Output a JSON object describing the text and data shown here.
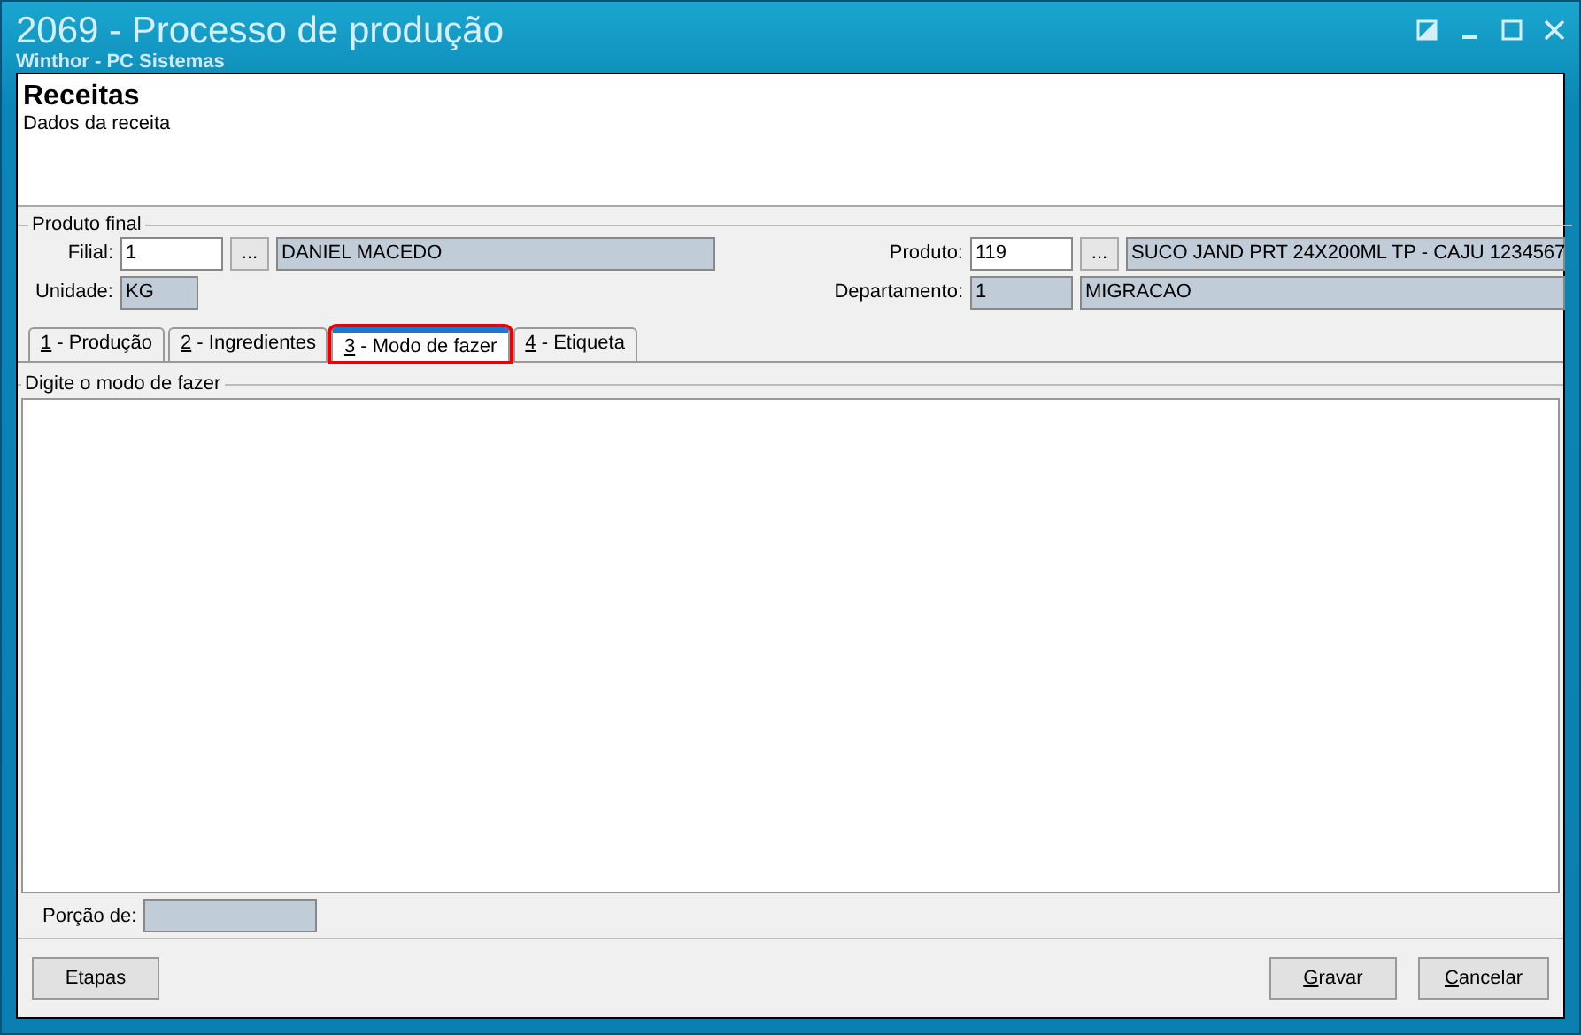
{
  "window": {
    "title": "2069 - Processo de produção",
    "subtitle": "Winthor - PC Sistemas"
  },
  "header": {
    "title": "Receitas",
    "subtitle": "Dados da receita"
  },
  "produto_final": {
    "legend": "Produto final",
    "filial": {
      "label": "Filial:",
      "value": "1",
      "lookup": "...",
      "name": "DANIEL MACEDO"
    },
    "unidade": {
      "label": "Unidade:",
      "value": "KG"
    },
    "produto": {
      "label": "Produto:",
      "value": "119",
      "lookup": "...",
      "name": "SUCO JAND PRT 24X200ML TP - CAJU 1234567"
    },
    "departamento": {
      "label": "Departamento:",
      "value": "1",
      "name": "MIGRACAO"
    }
  },
  "tabs": [
    {
      "label": "1 - Produção",
      "underline_first": true,
      "selected": false,
      "highlighted": false
    },
    {
      "label": "2 - Ingredientes",
      "underline_first": true,
      "selected": false,
      "highlighted": false
    },
    {
      "label": "3 - Modo de fazer",
      "underline_first": true,
      "selected": true,
      "highlighted": true
    },
    {
      "label": "4 - Etiqueta",
      "underline_first": true,
      "selected": false,
      "highlighted": false
    }
  ],
  "modo_de_fazer": {
    "legend": "Digite o modo de fazer"
  },
  "porcao": {
    "label": "Porção de:"
  },
  "buttons_left": [
    {
      "label": "Etapas",
      "underline_first": false
    }
  ],
  "buttons_right": [
    {
      "label": "Gravar",
      "underline_first": true
    },
    {
      "label": "Cancelar",
      "underline_first": true
    }
  ]
}
